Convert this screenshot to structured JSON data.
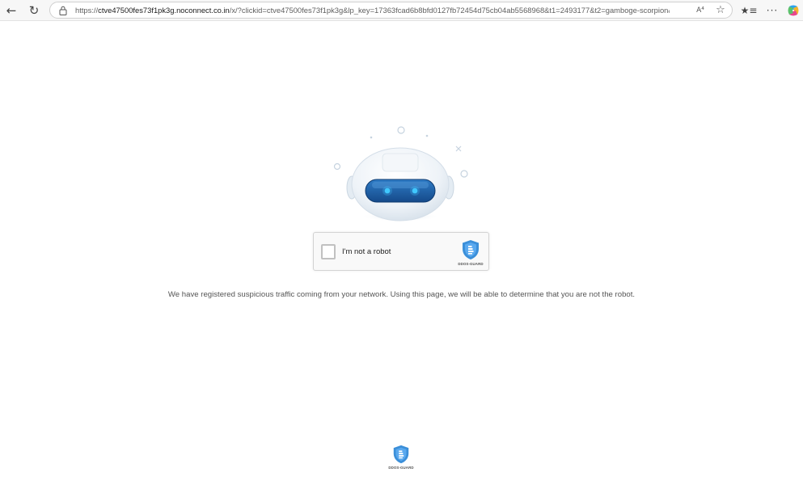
{
  "browser": {
    "url_scheme": "https://",
    "url_host": "ctve47500fes73f1pk3g.noconnect.co.in",
    "url_rest": "/x/?clickid=ctve47500fes73f1pk3g&lp_key=17363fcad6b8bfd0127fb72454d75cb04ab5568968&t1=2493177&t2=gamboge-scorpion&t...",
    "read_aloud_label": "A⁴",
    "icons": [
      "back-arrow-icon",
      "reload-icon",
      "lock-icon",
      "read-aloud-icon",
      "favorite-star-icon",
      "favorites-bar-icon",
      "more-menu-icon",
      "copilot-icon"
    ]
  },
  "captcha": {
    "label": "I'm not a robot",
    "checked": false,
    "brand": "DDOS-GUARD"
  },
  "message": "We have registered suspicious traffic coming from your network. Using this page, we will be able to determine that you are not the robot.",
  "footer": {
    "brand": "DDOS-GUARD"
  },
  "colors": {
    "shield_blue": "#3b8fd9",
    "robot_visor": "#1e5fa8",
    "robot_eye": "#41c9ff",
    "page_background": "#ffffff"
  }
}
